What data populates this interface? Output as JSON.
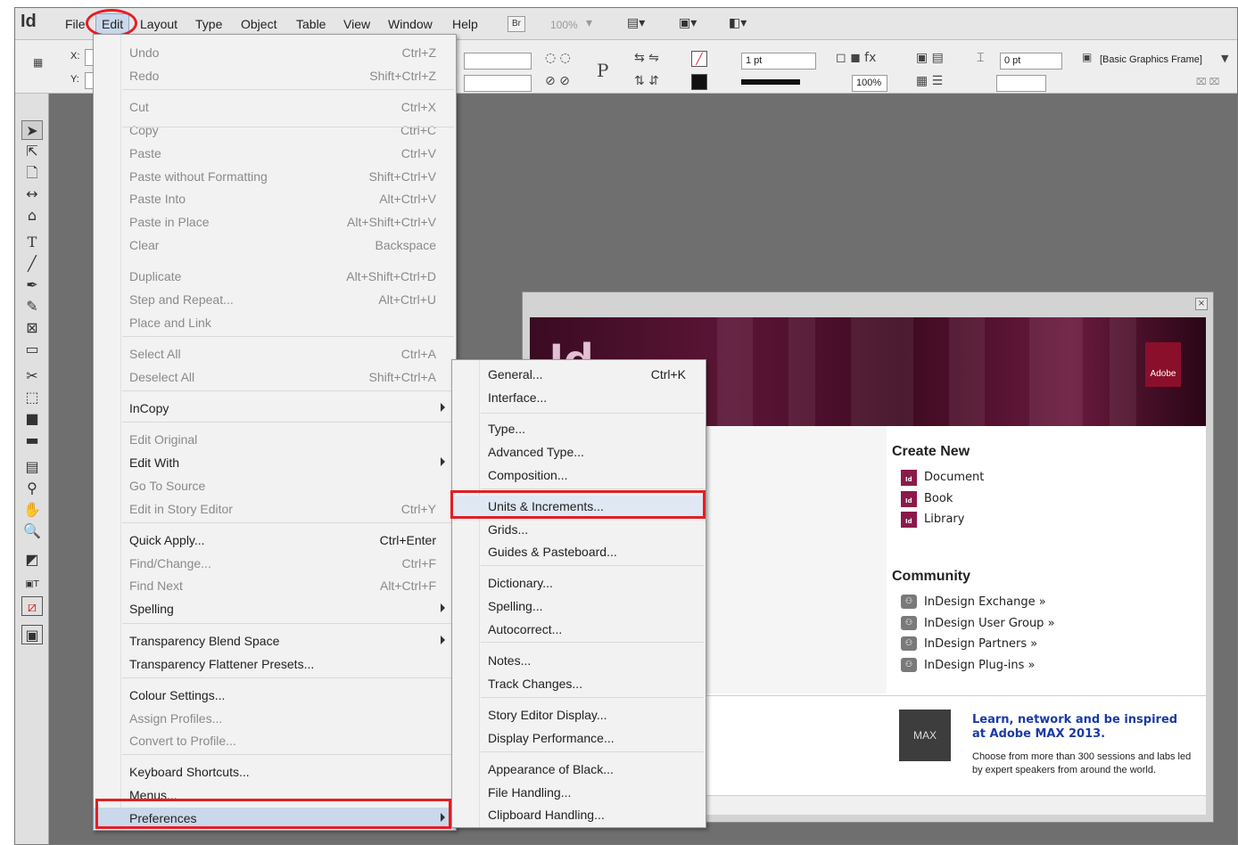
{
  "app": {
    "logo": "Id"
  },
  "menubar": {
    "items": [
      "File",
      "Edit",
      "Layout",
      "Type",
      "Object",
      "Table",
      "View",
      "Window",
      "Help"
    ],
    "bridge_label": "Br",
    "zoom": "100%"
  },
  "controlbar": {
    "x_label": "X:",
    "y_label": "Y:",
    "stroke_weight": "1 pt",
    "opacity": "100%",
    "offset": "0 pt",
    "frame_style": "[Basic Graphics Frame]",
    "ref_p": "P"
  },
  "edit_menu": {
    "items": [
      {
        "label": "Undo",
        "shortcut": "Ctrl+Z",
        "dim": true
      },
      {
        "label": "Redo",
        "shortcut": "Shift+Ctrl+Z",
        "dim": true
      },
      {
        "label": "Cut",
        "shortcut": "Ctrl+X",
        "dim": true
      },
      {
        "label": "Copy",
        "shortcut": "Ctrl+C",
        "dim": true
      },
      {
        "label": "Paste",
        "shortcut": "Ctrl+V",
        "dim": true
      },
      {
        "label": "Paste without Formatting",
        "shortcut": "Shift+Ctrl+V",
        "dim": true
      },
      {
        "label": "Paste Into",
        "shortcut": "Alt+Ctrl+V",
        "dim": true
      },
      {
        "label": "Paste in Place",
        "shortcut": "Alt+Shift+Ctrl+V",
        "dim": true
      },
      {
        "label": "Clear",
        "shortcut": "Backspace",
        "dim": true
      },
      {
        "label": "Duplicate",
        "shortcut": "Alt+Shift+Ctrl+D",
        "dim": true
      },
      {
        "label": "Step and Repeat...",
        "shortcut": "Alt+Ctrl+U",
        "dim": true
      },
      {
        "label": "Place and Link",
        "shortcut": "",
        "dim": true
      },
      {
        "label": "Select All",
        "shortcut": "Ctrl+A",
        "dim": true
      },
      {
        "label": "Deselect All",
        "shortcut": "Shift+Ctrl+A",
        "dim": true
      },
      {
        "label": "InCopy",
        "shortcut": "",
        "dim": false
      },
      {
        "label": "Edit Original",
        "shortcut": "",
        "dim": true
      },
      {
        "label": "Edit With",
        "shortcut": "",
        "dim": false
      },
      {
        "label": "Go To Source",
        "shortcut": "",
        "dim": true
      },
      {
        "label": "Edit in Story Editor",
        "shortcut": "Ctrl+Y",
        "dim": true
      },
      {
        "label": "Quick Apply...",
        "shortcut": "Ctrl+Enter",
        "dim": false
      },
      {
        "label": "Find/Change...",
        "shortcut": "Ctrl+F",
        "dim": true
      },
      {
        "label": "Find Next",
        "shortcut": "Alt+Ctrl+F",
        "dim": true
      },
      {
        "label": "Spelling",
        "shortcut": "",
        "dim": false
      },
      {
        "label": "Transparency Blend Space",
        "shortcut": "",
        "dim": false
      },
      {
        "label": "Transparency Flattener Presets...",
        "shortcut": "",
        "dim": false
      },
      {
        "label": "Colour Settings...",
        "shortcut": "",
        "dim": false
      },
      {
        "label": "Assign Profiles...",
        "shortcut": "",
        "dim": true
      },
      {
        "label": "Convert to Profile...",
        "shortcut": "",
        "dim": true
      },
      {
        "label": "Keyboard Shortcuts...",
        "shortcut": "",
        "dim": false
      },
      {
        "label": "Menus...",
        "shortcut": "",
        "dim": false
      },
      {
        "label": "Preferences",
        "shortcut": "",
        "dim": false
      }
    ]
  },
  "preferences_menu": {
    "items": [
      {
        "label": "General...",
        "shortcut": "Ctrl+K"
      },
      {
        "label": "Interface...",
        "shortcut": ""
      },
      {
        "label": "Type...",
        "shortcut": ""
      },
      {
        "label": "Advanced Type...",
        "shortcut": ""
      },
      {
        "label": "Composition...",
        "shortcut": ""
      },
      {
        "label": "Units & Increments...",
        "shortcut": ""
      },
      {
        "label": "Grids...",
        "shortcut": ""
      },
      {
        "label": "Guides & Pasteboard...",
        "shortcut": ""
      },
      {
        "label": "Dictionary...",
        "shortcut": ""
      },
      {
        "label": "Spelling...",
        "shortcut": ""
      },
      {
        "label": "Autocorrect...",
        "shortcut": ""
      },
      {
        "label": "Notes...",
        "shortcut": ""
      },
      {
        "label": "Track Changes...",
        "shortcut": ""
      },
      {
        "label": "Story Editor Display...",
        "shortcut": ""
      },
      {
        "label": "Display Performance...",
        "shortcut": ""
      },
      {
        "label": "Appearance of Black...",
        "shortcut": ""
      },
      {
        "label": "File Handling...",
        "shortcut": ""
      },
      {
        "label": "Clipboard Handling...",
        "shortcut": ""
      }
    ]
  },
  "welcome": {
    "banner_logo": "Id",
    "adobe_label": "Adobe",
    "create_new": {
      "title": "Create New",
      "items": [
        "Document",
        "Book",
        "Library"
      ]
    },
    "community": {
      "title": "Community",
      "items": [
        "InDesign Exchange »",
        "InDesign User Group »",
        "InDesign Partners »",
        "InDesign Plug-ins »"
      ]
    },
    "max": {
      "logo": "MAX",
      "title": "Learn, network and be inspired at Adobe MAX 2013.",
      "description": "Choose from more than 300 sessions and labs led by expert speakers from around the world."
    }
  }
}
